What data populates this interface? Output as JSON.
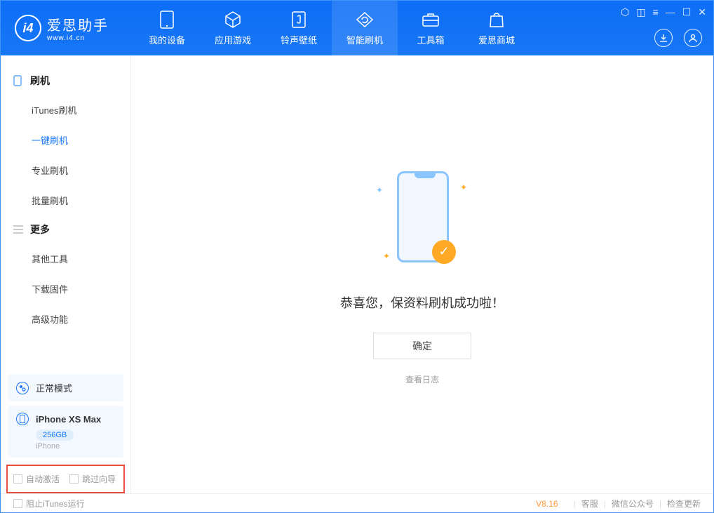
{
  "app": {
    "title": "爱思助手",
    "subtitle": "www.i4.cn"
  },
  "tabs": {
    "device": "我的设备",
    "apps": "应用游戏",
    "ringtone": "铃声壁纸",
    "flash": "智能刷机",
    "toolbox": "工具箱",
    "store": "爱思商城"
  },
  "sidebar": {
    "group_flash": "刷机",
    "items_flash": {
      "itunes": "iTunes刷机",
      "oneclick": "一键刷机",
      "pro": "专业刷机",
      "batch": "批量刷机"
    },
    "group_more": "更多",
    "items_more": {
      "other": "其他工具",
      "firmware": "下载固件",
      "advanced": "高级功能"
    }
  },
  "status": {
    "mode": "正常模式"
  },
  "device": {
    "name": "iPhone XS Max",
    "storage": "256GB",
    "type": "iPhone"
  },
  "checks": {
    "auto_activate": "自动激活",
    "skip_wizard": "跳过向导"
  },
  "main": {
    "success": "恭喜您，保资料刷机成功啦！",
    "ok": "确定",
    "view_log": "查看日志"
  },
  "footer": {
    "block_itunes": "阻止iTunes运行",
    "version": "V8.16",
    "support": "客服",
    "wechat": "微信公众号",
    "update": "检查更新"
  }
}
